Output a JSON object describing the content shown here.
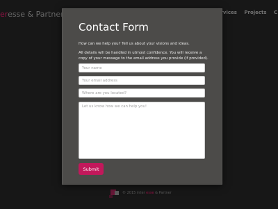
{
  "site": {
    "brand_accent": "er",
    "brand_rest": "esse & Partner",
    "nav": [
      "Services",
      "Projects",
      "C"
    ]
  },
  "modal": {
    "title": "Contact Form",
    "intro": "How can we help you? Tell us about your visions and ideas.",
    "privacy": "All details will be handled in utmost confidence. You will receive a copy of your message to the email address you provide (if provided).",
    "fields": {
      "name_placeholder": "Your name",
      "email_placeholder": "Your email address",
      "location_placeholder": "Where are you located?",
      "message_placeholder": "Let us know how we can help you!"
    },
    "submit_label": "Submit"
  },
  "footer": {
    "copyright": "© 2015",
    "company_a": "inter",
    "company_b": "esse",
    "company_c": "& Partner"
  },
  "colors": {
    "accent": "#c2185b",
    "modal_bg": "#4c4b49",
    "page_bg": "#1f1f1f"
  }
}
